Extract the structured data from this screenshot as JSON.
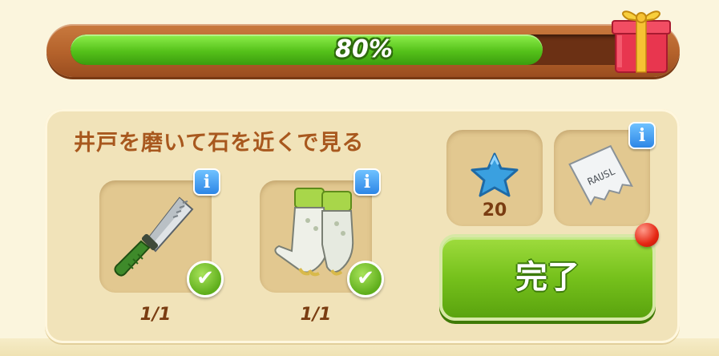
{
  "progress": {
    "label": "80%",
    "value": 0.8
  },
  "quest": {
    "title": "井戸を磨いて石を近くで見る"
  },
  "items": [
    {
      "icon": "knife-icon",
      "count": "1/1",
      "done": true
    },
    {
      "icon": "gloves-icon",
      "count": "1/1",
      "done": true
    }
  ],
  "rewards": [
    {
      "icon": "blue-star-icon",
      "count": "20"
    },
    {
      "icon": "paper-note-icon",
      "count": ""
    }
  ],
  "note_text": "RAUSL",
  "complete_button": {
    "label": "完了"
  },
  "info_glyph": "i",
  "check_glyph": "✔",
  "colors": {
    "accent_green": "#76c11c",
    "frame_brown": "#b4622b",
    "title_brown": "#a8581e"
  }
}
